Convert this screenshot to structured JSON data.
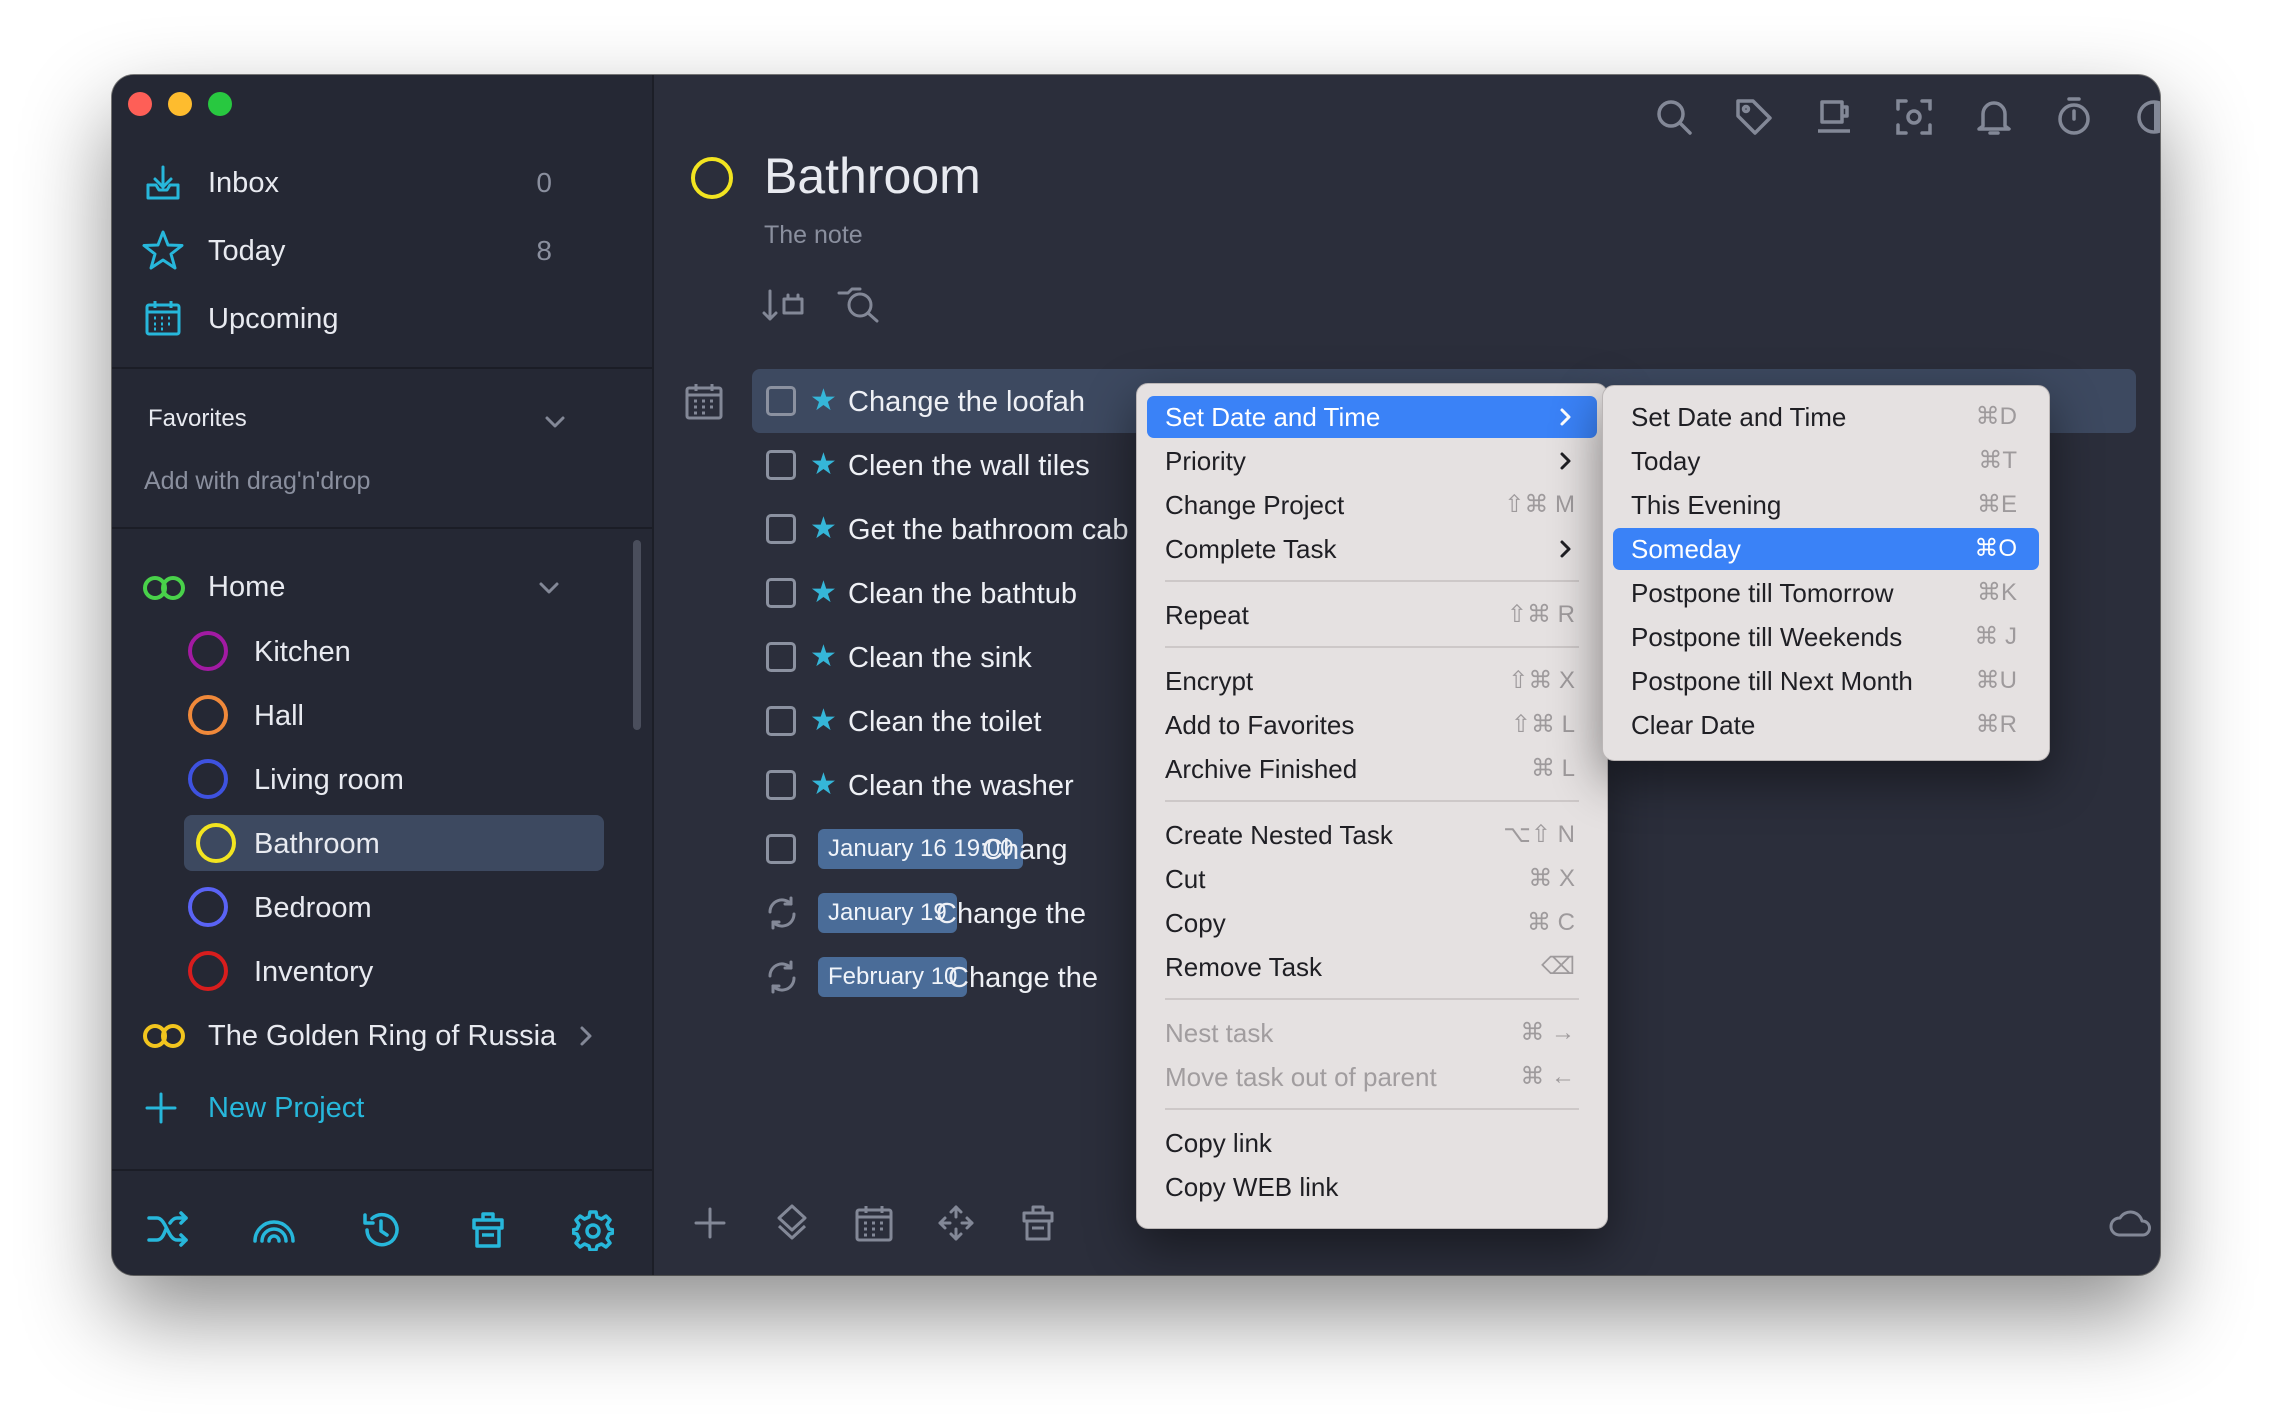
{
  "sidebar": {
    "inbox": {
      "label": "Inbox",
      "count": "0"
    },
    "today": {
      "label": "Today",
      "count": "8"
    },
    "upcoming": {
      "label": "Upcoming"
    },
    "favorites": {
      "title": "Favorites",
      "hint": "Add with drag'n'drop"
    },
    "projects": [
      {
        "label": "Home",
        "color": "#49d14a"
      },
      {
        "label": "Kitchen",
        "color": "#a21aa3"
      },
      {
        "label": "Hall",
        "color": "#f0893a"
      },
      {
        "label": "Living room",
        "color": "#3e52e0"
      },
      {
        "label": "Bathroom",
        "color": "#f2e420"
      },
      {
        "label": "Bedroom",
        "color": "#5a63f5"
      },
      {
        "label": "Inventory",
        "color": "#d81d1d"
      },
      {
        "label": "The Golden Ring of Russia",
        "color": "#f2c51e"
      }
    ],
    "new_project": "New Project"
  },
  "header": {
    "title": "Bathroom",
    "note": "The note"
  },
  "tasks": [
    {
      "title": "Change the loofah",
      "starred": true
    },
    {
      "title": "Cleen the wall tiles",
      "starred": true
    },
    {
      "title": "Get the bathroom cab",
      "starred": true
    },
    {
      "title": "Clean the bathtub",
      "starred": true
    },
    {
      "title": "Clean the sink",
      "starred": true
    },
    {
      "title": "Clean the toilet",
      "starred": true
    },
    {
      "title": "Clean the washer",
      "starred": true
    },
    {
      "title": "Chang",
      "date": "January 16 19:00"
    },
    {
      "title": "Change the",
      "date": "January 19",
      "repeat": true
    },
    {
      "title": "Change the",
      "date": "February 10",
      "repeat": true
    }
  ],
  "context_menu": {
    "set_date": "Set Date and Time",
    "priority": "Priority",
    "change_project": {
      "label": "Change Project",
      "shortcut": "⇧⌘ M"
    },
    "complete": "Complete Task",
    "repeat": {
      "label": "Repeat",
      "shortcut": "⇧⌘ R"
    },
    "encrypt": {
      "label": "Encrypt",
      "shortcut": "⇧⌘ X"
    },
    "add_fav": {
      "label": "Add to Favorites",
      "shortcut": "⇧⌘ L"
    },
    "archive": {
      "label": "Archive Finished",
      "shortcut": "⌘ L"
    },
    "nested": {
      "label": "Create Nested Task",
      "shortcut": "⌥⇧ N"
    },
    "cut": {
      "label": "Cut",
      "shortcut": "⌘ X"
    },
    "copy": {
      "label": "Copy",
      "shortcut": "⌘ C"
    },
    "remove": {
      "label": "Remove Task",
      "shortcut": "⌫"
    },
    "nest": {
      "label": "Nest task",
      "shortcut": "⌘ →"
    },
    "move_out": {
      "label": "Move task out of parent",
      "shortcut": "⌘ ←"
    },
    "copy_link": "Copy link",
    "copy_web": "Copy WEB link"
  },
  "submenu": [
    {
      "label": "Set Date and Time",
      "shortcut": "⌘D"
    },
    {
      "label": "Today",
      "shortcut": "⌘T"
    },
    {
      "label": "This Evening",
      "shortcut": "⌘E"
    },
    {
      "label": "Someday",
      "shortcut": "⌘O"
    },
    {
      "label": "Postpone till Tomorrow",
      "shortcut": "⌘K"
    },
    {
      "label": "Postpone till Weekends",
      "shortcut": "⌘ J"
    },
    {
      "label": "Postpone till Next Month",
      "shortcut": "⌘U"
    },
    {
      "label": "Clear Date",
      "shortcut": "⌘R"
    }
  ]
}
